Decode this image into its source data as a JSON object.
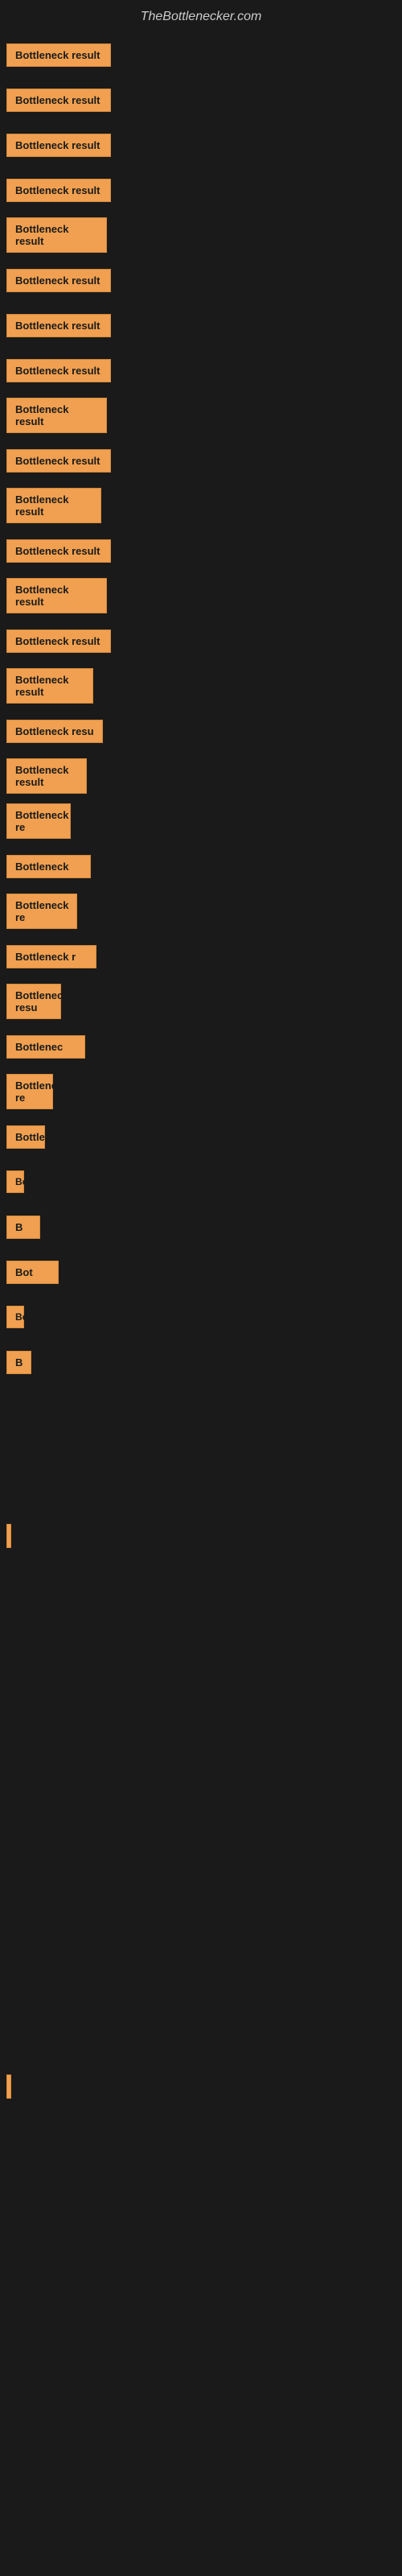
{
  "site": {
    "title": "TheBottlenecker.com"
  },
  "items": [
    {
      "label": "Bottleneck result",
      "visible": true
    },
    {
      "label": "Bottleneck result",
      "visible": true
    },
    {
      "label": "Bottleneck result",
      "visible": true
    },
    {
      "label": "Bottleneck result",
      "visible": true
    },
    {
      "label": "Bottleneck result",
      "visible": true
    },
    {
      "label": "Bottleneck result",
      "visible": true
    },
    {
      "label": "Bottleneck result",
      "visible": true
    },
    {
      "label": "Bottleneck result",
      "visible": true
    },
    {
      "label": "Bottleneck result",
      "visible": true
    },
    {
      "label": "Bottleneck result",
      "visible": true
    },
    {
      "label": "Bottleneck result",
      "visible": true
    },
    {
      "label": "Bottleneck result",
      "visible": true
    },
    {
      "label": "Bottleneck result",
      "visible": true
    },
    {
      "label": "Bottleneck result",
      "visible": true
    },
    {
      "label": "Bottleneck result",
      "visible": true
    },
    {
      "label": "Bottleneck resu",
      "visible": true
    },
    {
      "label": "Bottleneck result",
      "visible": true
    },
    {
      "label": "Bottleneck re",
      "visible": true
    },
    {
      "label": "Bottleneck",
      "visible": true
    },
    {
      "label": "Bottleneck re",
      "visible": true
    },
    {
      "label": "Bottleneck r",
      "visible": true
    },
    {
      "label": "Bottleneck resu",
      "visible": true
    },
    {
      "label": "Bottlenec",
      "visible": true
    },
    {
      "label": "Bottleneck re",
      "visible": true
    },
    {
      "label": "Bottle",
      "visible": true
    },
    {
      "label": "Bott",
      "visible": true
    },
    {
      "label": "B",
      "visible": true
    },
    {
      "label": "Bot",
      "visible": true
    },
    {
      "label": "Bottlen",
      "visible": true
    },
    {
      "label": "B",
      "visible": true
    }
  ],
  "colors": {
    "background": "#1a1a1a",
    "bar": "#f0a050",
    "bar_border": "#d4893a",
    "text": "#cccccc"
  }
}
